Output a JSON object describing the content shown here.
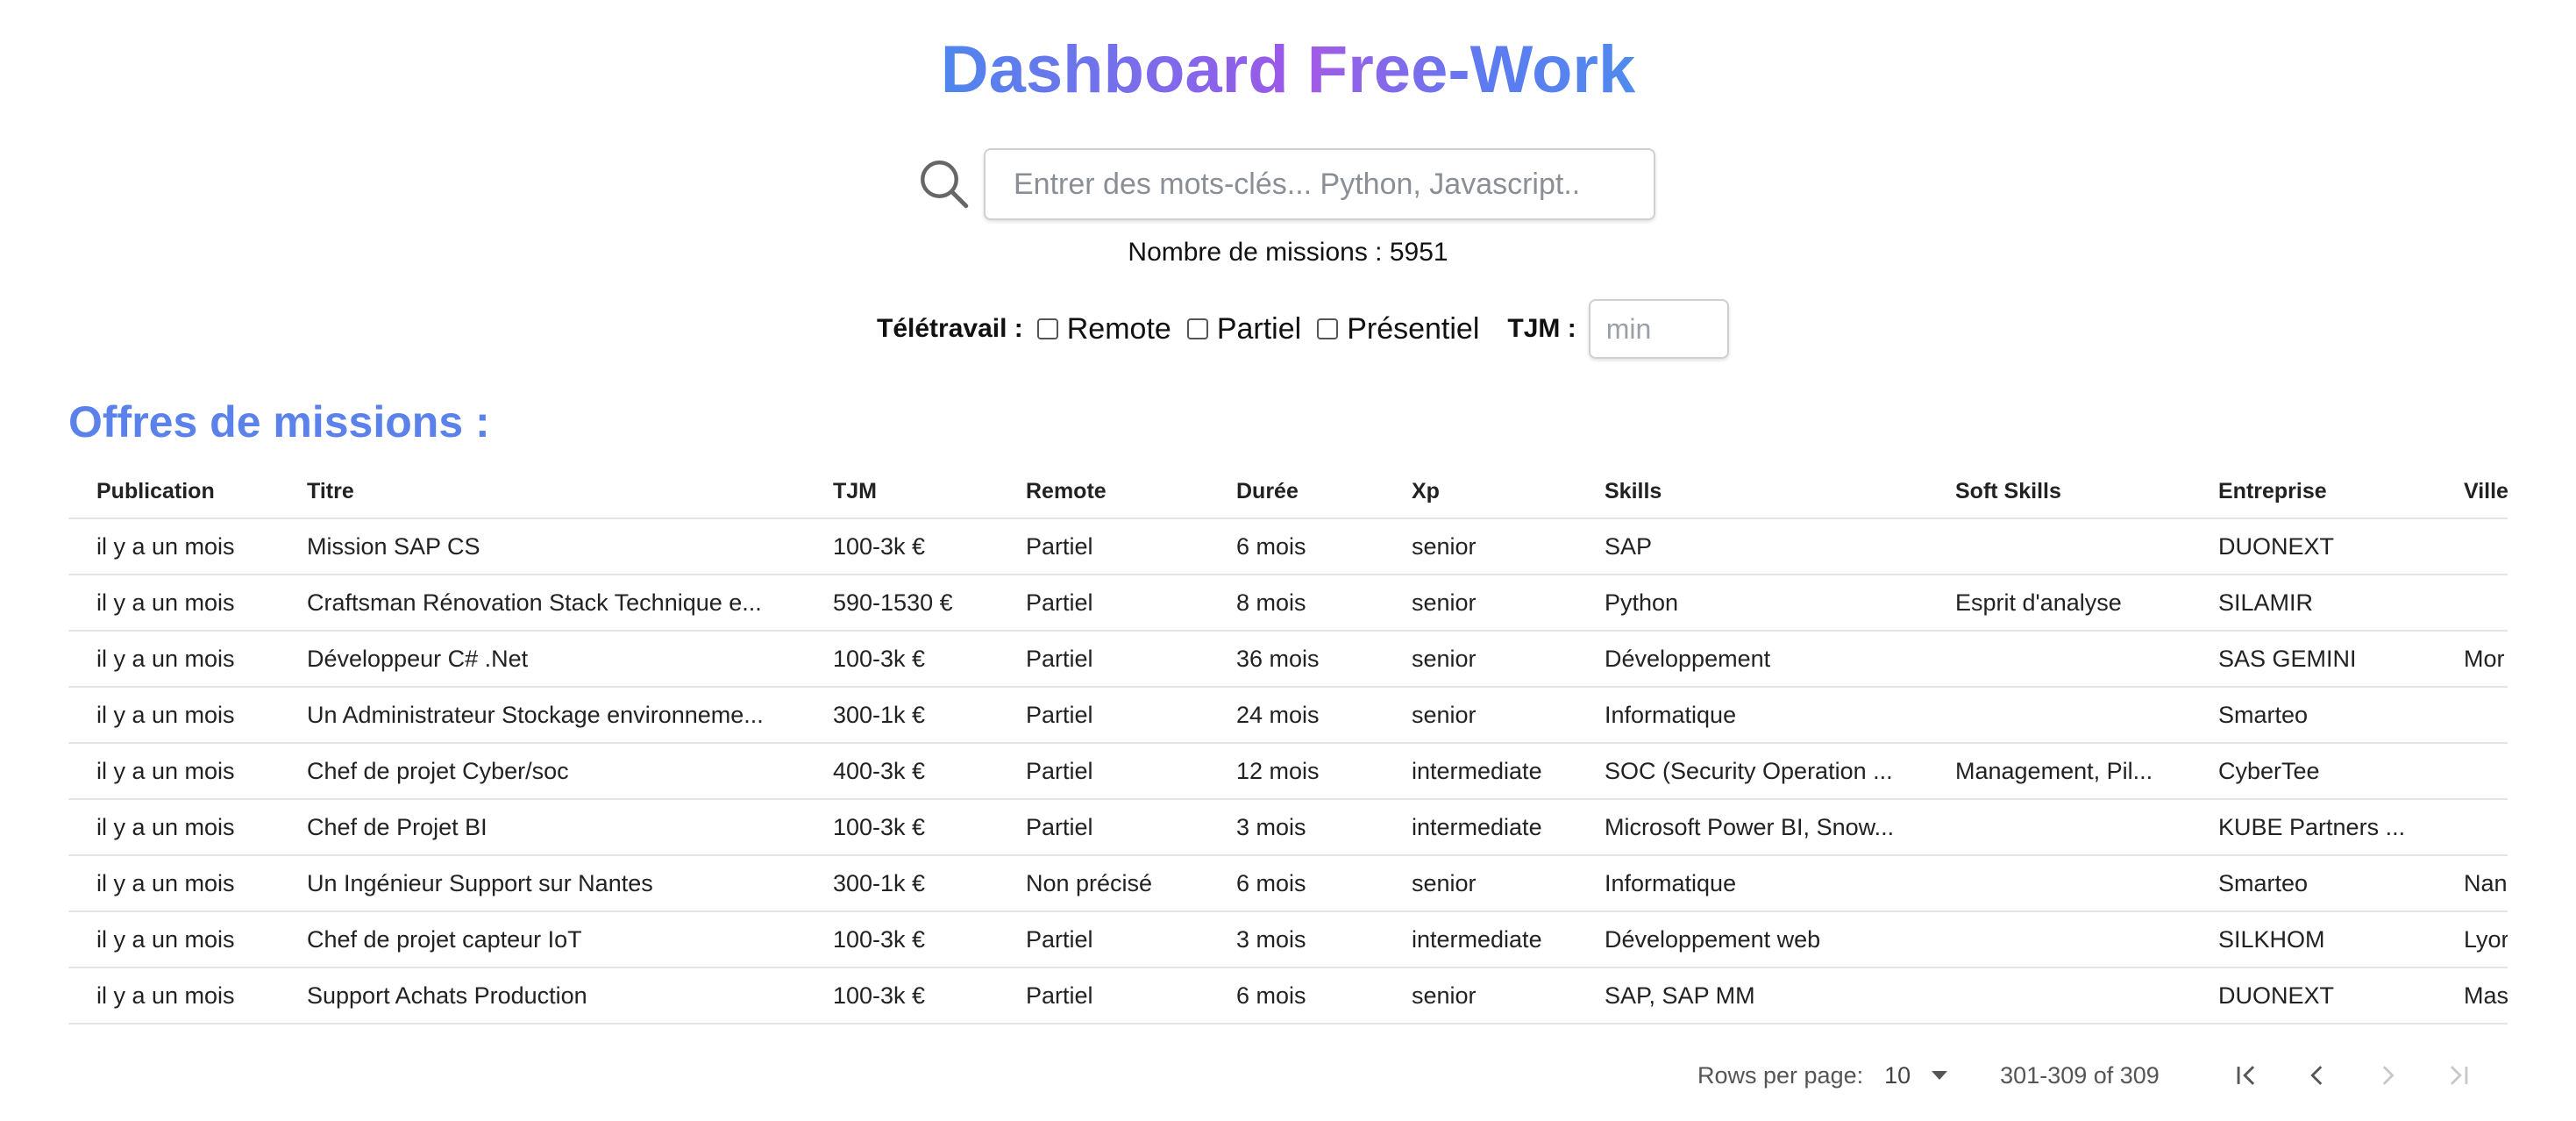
{
  "header": {
    "title_part1": "Dashboard",
    "title_part2": "Free-Work"
  },
  "search": {
    "placeholder": "Entrer des mots-clés... Python, Javascript..",
    "value": ""
  },
  "summary": {
    "count_label": "Nombre de missions : 5951"
  },
  "filters": {
    "teletravail_label": "Télétravail :",
    "options": [
      "Remote",
      "Partiel",
      "Présentiel"
    ],
    "tjm_label": "TJM :",
    "tjm_placeholder": "min"
  },
  "section": {
    "title": "Offres de missions :"
  },
  "table": {
    "columns": [
      "Publication",
      "Titre",
      "TJM",
      "Remote",
      "Durée",
      "Xp",
      "Skills",
      "Soft Skills",
      "Entreprise",
      "Ville"
    ],
    "rows": [
      [
        "il y a un mois",
        "Mission SAP CS",
        "100-3k €",
        "Partiel",
        "6 mois",
        "senior",
        "SAP",
        "",
        "DUONEXT",
        ""
      ],
      [
        "il y a un mois",
        "Craftsman Rénovation Stack Technique e...",
        "590-1530 €",
        "Partiel",
        "8 mois",
        "senior",
        "Python",
        "Esprit d'analyse",
        "SILAMIR",
        ""
      ],
      [
        "il y a un mois",
        "Développeur C# .Net",
        "100-3k €",
        "Partiel",
        "36 mois",
        "senior",
        "Développement",
        "",
        "SAS GEMINI",
        "Mor"
      ],
      [
        "il y a un mois",
        "Un Administrateur Stockage environneme...",
        "300-1k €",
        "Partiel",
        "24 mois",
        "senior",
        "Informatique",
        "",
        "Smarteo",
        ""
      ],
      [
        "il y a un mois",
        "Chef de projet Cyber/soc",
        "400-3k €",
        "Partiel",
        "12 mois",
        "intermediate",
        "SOC (Security Operation ...",
        "Management, Pil...",
        "CyberTee",
        ""
      ],
      [
        "il y a un mois",
        "Chef de Projet BI",
        "100-3k €",
        "Partiel",
        "3 mois",
        "intermediate",
        "Microsoft Power BI, Snow...",
        "",
        "KUBE Partners ...",
        ""
      ],
      [
        "il y a un mois",
        "Un Ingénieur Support sur Nantes",
        "300-1k €",
        "Non précisé",
        "6 mois",
        "senior",
        "Informatique",
        "",
        "Smarteo",
        "Nan"
      ],
      [
        "il y a un mois",
        "Chef de projet capteur IoT",
        "100-3k €",
        "Partiel",
        "3 mois",
        "intermediate",
        "Développement web",
        "",
        "SILKHOM",
        "Lyor"
      ],
      [
        "il y a un mois",
        "Support Achats Production",
        "100-3k €",
        "Partiel",
        "6 mois",
        "senior",
        "SAP, SAP MM",
        "",
        "DUONEXT",
        "Mas"
      ]
    ]
  },
  "pagination": {
    "rows_per_page_label": "Rows per page:",
    "rows_per_page_value": "10",
    "range_label": "301-309 of 309"
  },
  "colors": {
    "accent": "#5a82ea",
    "title_gradient_start": "#4f86ee",
    "title_gradient_end": "#9b59e8"
  }
}
